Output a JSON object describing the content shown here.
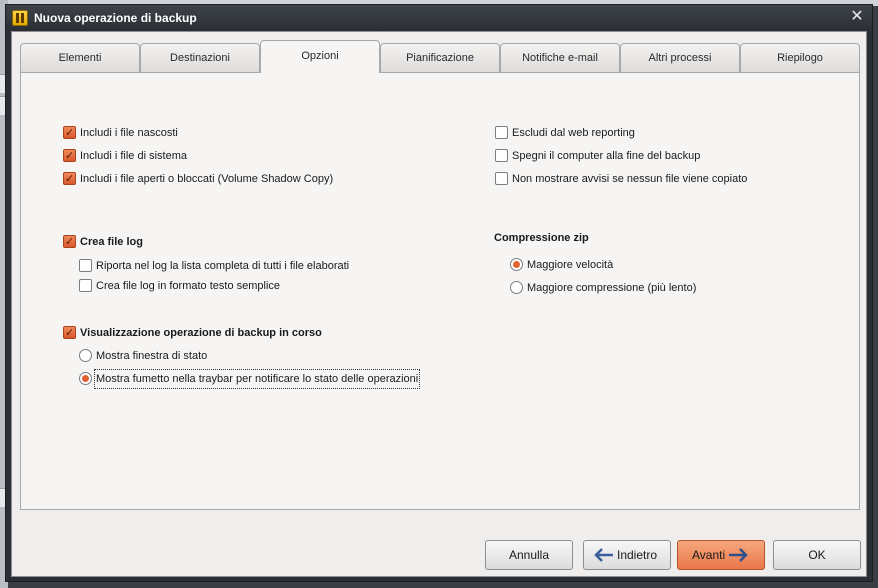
{
  "window": {
    "title": "Nuova operazione di backup"
  },
  "tabs": [
    {
      "label": "Elementi"
    },
    {
      "label": "Destinazioni"
    },
    {
      "label": "Opzioni"
    },
    {
      "label": "Pianificazione"
    },
    {
      "label": "Notifiche e-mail"
    },
    {
      "label": "Altri processi"
    },
    {
      "label": "Riepilogo"
    }
  ],
  "active_tab": "Opzioni",
  "options": {
    "left": [
      {
        "label": "Includi i file nascosti",
        "checked": true
      },
      {
        "label": "Includi i file di sistema",
        "checked": true
      },
      {
        "label": "Includi i file aperti o bloccati (Volume Shadow Copy)",
        "checked": true
      }
    ],
    "right": [
      {
        "label": "Escludi dal web reporting",
        "checked": false
      },
      {
        "label": "Spegni il computer alla fine del backup",
        "checked": false
      },
      {
        "label": "Non mostrare avvisi se nessun file viene copiato",
        "checked": false
      }
    ]
  },
  "log": {
    "label": "Crea file log",
    "checked": true,
    "items": [
      {
        "label": "Riporta nel log la lista completa di tutti i file elaborati",
        "checked": false
      },
      {
        "label": "Crea file log in formato testo semplice",
        "checked": false
      }
    ]
  },
  "zip": {
    "title": "Compressione zip",
    "options": [
      {
        "label": "Maggiore velocità",
        "selected": true
      },
      {
        "label": "Maggiore compressione (più lento)",
        "selected": false
      }
    ]
  },
  "display": {
    "label": "Visualizzazione operazione di backup in corso",
    "checked": true,
    "options": [
      {
        "label": "Mostra finestra di stato",
        "selected": false
      },
      {
        "label": "Mostra fumetto nella traybar per notificare lo stato delle operazioni",
        "selected": true
      }
    ]
  },
  "buttons": {
    "cancel": "Annulla",
    "back": "Indietro",
    "next": "Avanti",
    "ok": "OK"
  },
  "colors": {
    "accent": "#e9784a",
    "titlebar": "#2e3238"
  }
}
